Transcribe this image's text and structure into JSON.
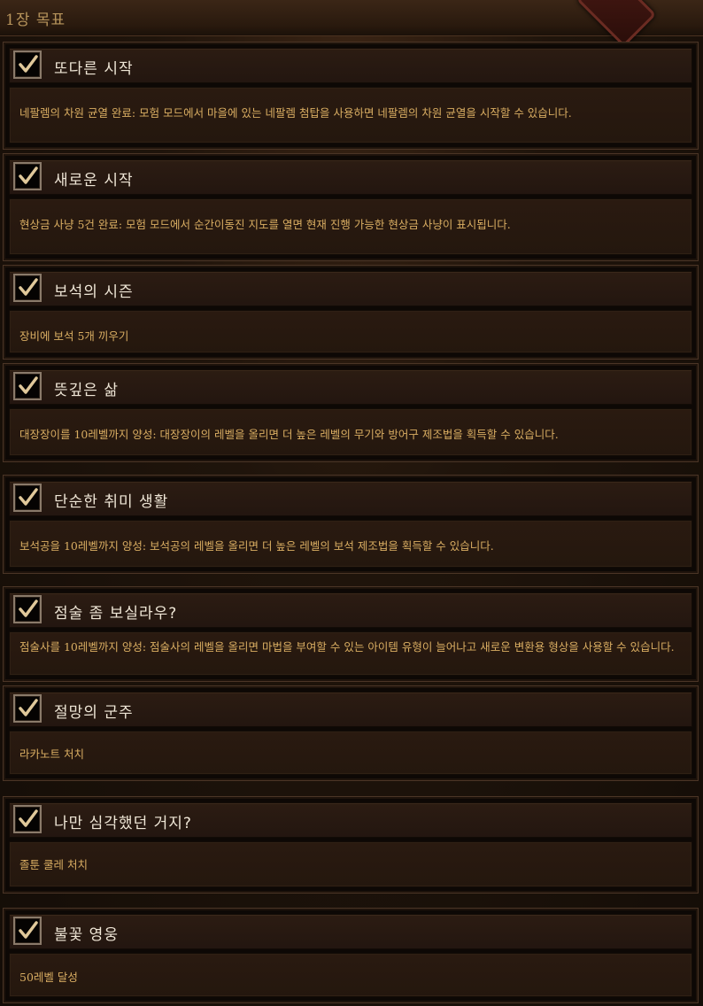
{
  "header": {
    "chapter_title": "1장 목표"
  },
  "colors": {
    "accent_text": "#d9ad62",
    "title_text": "#efe6d6",
    "check_mark": "#e0c89a"
  },
  "objectives": [
    {
      "title": "또다른 시작",
      "description": "네팔렘의 차원 균열 완료: 모험 모드에서 마을에 있는 네팔렘 첨탑을 사용하면 네팔렘의 차원 균열을 시작할 수 있습니다.",
      "completed": true,
      "icon": "check-icon"
    },
    {
      "title": "새로운 시작",
      "description": "현상금 사냥 5건 완료: 모험 모드에서 순간이동진 지도를 열면 현재 진행 가능한 현상금 사냥이 표시됩니다.",
      "completed": true,
      "icon": "check-icon"
    },
    {
      "title": "보석의 시즌",
      "description": "장비에 보석 5개 끼우기",
      "completed": true,
      "icon": "check-icon"
    },
    {
      "title": "뜻깊은 삶",
      "description": "대장장이를 10레벨까지 양성: 대장장이의 레벨을 올리면 더 높은 레벨의 무기와 방어구 제조법을 획득할 수 있습니다.",
      "completed": true,
      "icon": "check-icon"
    },
    {
      "title": "단순한 취미 생활",
      "description": "보석공을 10레벨까지 양성: 보석공의 레벨을 올리면 더 높은 레벨의 보석 제조법을 획득할 수 있습니다.",
      "completed": true,
      "icon": "check-icon"
    },
    {
      "title": "점술 좀 보실라우?",
      "description": "점술사를 10레벨까지 양성: 점술사의 레벨을 올리면 마법을 부여할 수 있는 아이템 유형이 늘어나고 새로운 변환용 형상을 사용할 수 있습니다.",
      "completed": true,
      "icon": "check-icon"
    },
    {
      "title": "절망의 군주",
      "description": "라카노트 처치",
      "completed": true,
      "icon": "check-icon"
    },
    {
      "title": "나만 심각했던 거지?",
      "description": "졸툰 쿨레 처치",
      "completed": true,
      "icon": "check-icon"
    },
    {
      "title": "불꽃 영웅",
      "description": "50레벨 달성",
      "completed": true,
      "icon": "check-icon"
    }
  ]
}
